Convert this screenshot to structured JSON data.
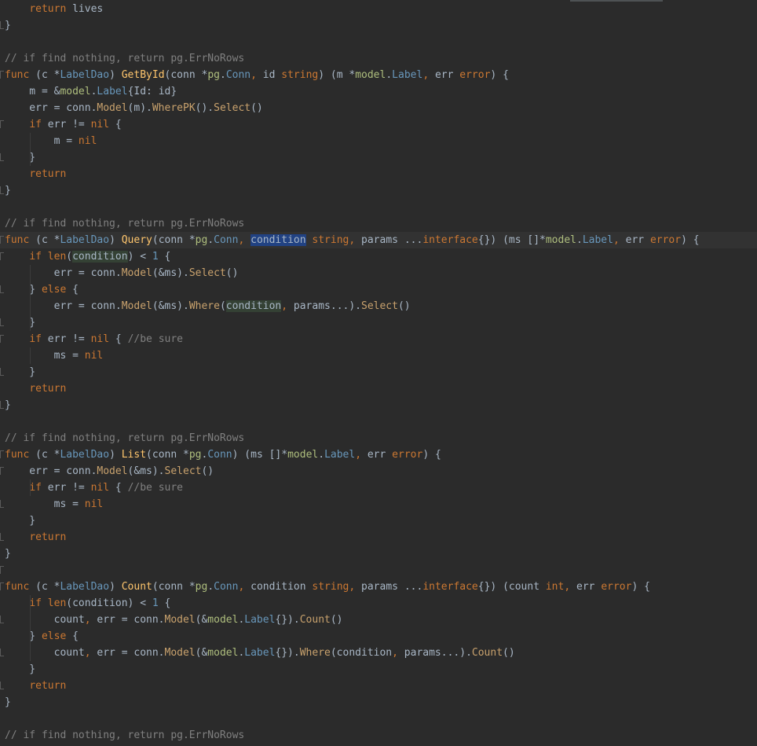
{
  "editor": {
    "lines": [
      [
        [
          "    "
        ],
        [
          "return",
          "kw"
        ],
        [
          " lives"
        ]
      ],
      [
        [
          "}"
        ]
      ],
      [
        [
          ""
        ]
      ],
      [
        [
          "// if find nothing, return pg.ErrNoRows",
          "cm"
        ]
      ],
      [
        [
          "func",
          "kw"
        ],
        [
          " (c *"
        ],
        [
          "LabelDao",
          "ty"
        ],
        [
          ") "
        ],
        [
          "GetById",
          "fn"
        ],
        [
          "(conn *"
        ],
        [
          "pg",
          "pk"
        ],
        [
          "."
        ],
        [
          "Conn",
          "ty"
        ],
        [
          ", ",
          "kw"
        ],
        [
          "id "
        ],
        [
          "string",
          "kw"
        ],
        [
          ") (m *"
        ],
        [
          "model",
          "pk"
        ],
        [
          "."
        ],
        [
          "Label",
          "ty"
        ],
        [
          ", ",
          "kw"
        ],
        [
          "err "
        ],
        [
          "error",
          "kw"
        ],
        [
          ") {"
        ]
      ],
      [
        [
          "    m = &"
        ],
        [
          "model",
          "pk"
        ],
        [
          "."
        ],
        [
          "Label",
          "ty"
        ],
        [
          "{Id: id}"
        ]
      ],
      [
        [
          "    err = conn."
        ],
        [
          "Model",
          "mcall"
        ],
        [
          "(m)."
        ],
        [
          "WherePK",
          "mcall"
        ],
        [
          "()."
        ],
        [
          "Select",
          "mcall"
        ],
        [
          "()"
        ]
      ],
      [
        [
          "    "
        ],
        [
          "if",
          "kw"
        ],
        [
          " err != "
        ],
        [
          "nil",
          "kw"
        ],
        [
          " {"
        ]
      ],
      [
        [
          "        m = "
        ],
        [
          "nil",
          "kw"
        ]
      ],
      [
        [
          "    }"
        ]
      ],
      [
        [
          "    "
        ],
        [
          "return",
          "kw"
        ]
      ],
      [
        [
          "}"
        ]
      ],
      [
        [
          ""
        ]
      ],
      [
        [
          "// if find nothing, return pg.ErrNoRows",
          "cm"
        ]
      ],
      [
        [
          "func",
          "kw"
        ],
        [
          " (c *"
        ],
        [
          "LabelDao",
          "ty"
        ],
        [
          ") "
        ],
        [
          "Query",
          "fn"
        ],
        [
          "(conn *"
        ],
        [
          "pg",
          "pk"
        ],
        [
          "."
        ],
        [
          "Conn",
          "ty"
        ],
        [
          ", ",
          "kw"
        ],
        [
          "condition",
          "hlsel"
        ],
        [
          " "
        ],
        [
          "string",
          "kw"
        ],
        [
          ", ",
          "kw"
        ],
        [
          "params ..."
        ],
        [
          "interface",
          "kw"
        ],
        [
          "{}) (ms []*"
        ],
        [
          "model",
          "pk"
        ],
        [
          "."
        ],
        [
          "Label",
          "ty"
        ],
        [
          ", ",
          "kw"
        ],
        [
          "err "
        ],
        [
          "error",
          "kw"
        ],
        [
          ") {"
        ]
      ],
      [
        [
          "    "
        ],
        [
          "if",
          "kw"
        ],
        [
          " "
        ],
        [
          "len",
          "kw"
        ],
        [
          "("
        ],
        [
          "condition",
          "hlref"
        ],
        [
          ") < "
        ],
        [
          "1",
          "nm"
        ],
        [
          " {"
        ]
      ],
      [
        [
          "        err = conn."
        ],
        [
          "Model",
          "mcall"
        ],
        [
          "(&ms)."
        ],
        [
          "Select",
          "mcall"
        ],
        [
          "()"
        ]
      ],
      [
        [
          "    } "
        ],
        [
          "else",
          "kw"
        ],
        [
          " {"
        ]
      ],
      [
        [
          "        err = conn."
        ],
        [
          "Model",
          "mcall"
        ],
        [
          "(&ms)."
        ],
        [
          "Where",
          "mcall"
        ],
        [
          "("
        ],
        [
          "condition",
          "hlref"
        ],
        [
          ", ",
          "kw"
        ],
        [
          "params...)."
        ],
        [
          "Select",
          "mcall"
        ],
        [
          "()"
        ]
      ],
      [
        [
          "    }"
        ]
      ],
      [
        [
          "    "
        ],
        [
          "if",
          "kw"
        ],
        [
          " err != "
        ],
        [
          "nil",
          "kw"
        ],
        [
          " { "
        ],
        [
          "//be sure",
          "cm"
        ]
      ],
      [
        [
          "        ms = "
        ],
        [
          "nil",
          "kw"
        ]
      ],
      [
        [
          "    }"
        ]
      ],
      [
        [
          "    "
        ],
        [
          "return",
          "kw"
        ]
      ],
      [
        [
          "}"
        ]
      ],
      [
        [
          ""
        ]
      ],
      [
        [
          "// if find nothing, return pg.ErrNoRows",
          "cm"
        ]
      ],
      [
        [
          "func",
          "kw"
        ],
        [
          " (c *"
        ],
        [
          "LabelDao",
          "ty"
        ],
        [
          ") "
        ],
        [
          "List",
          "fn"
        ],
        [
          "(conn *"
        ],
        [
          "pg",
          "pk"
        ],
        [
          "."
        ],
        [
          "Conn",
          "ty"
        ],
        [
          ") (ms []*"
        ],
        [
          "model",
          "pk"
        ],
        [
          "."
        ],
        [
          "Label",
          "ty"
        ],
        [
          ", ",
          "kw"
        ],
        [
          "err "
        ],
        [
          "error",
          "kw"
        ],
        [
          ") {"
        ]
      ],
      [
        [
          "    err = conn."
        ],
        [
          "Model",
          "mcall"
        ],
        [
          "(&ms)."
        ],
        [
          "Select",
          "mcall"
        ],
        [
          "()"
        ]
      ],
      [
        [
          "    "
        ],
        [
          "if",
          "kw"
        ],
        [
          " err != "
        ],
        [
          "nil",
          "kw"
        ],
        [
          " { "
        ],
        [
          "//be sure",
          "cm"
        ]
      ],
      [
        [
          "        ms = "
        ],
        [
          "nil",
          "kw"
        ]
      ],
      [
        [
          "    }"
        ]
      ],
      [
        [
          "    "
        ],
        [
          "return",
          "kw"
        ]
      ],
      [
        [
          "}"
        ]
      ],
      [
        [
          ""
        ]
      ],
      [
        [
          "func",
          "kw"
        ],
        [
          " (c *"
        ],
        [
          "LabelDao",
          "ty"
        ],
        [
          ") "
        ],
        [
          "Count",
          "fn"
        ],
        [
          "(conn *"
        ],
        [
          "pg",
          "pk"
        ],
        [
          "."
        ],
        [
          "Conn",
          "ty"
        ],
        [
          ", ",
          "kw"
        ],
        [
          "condition "
        ],
        [
          "string",
          "kw"
        ],
        [
          ", ",
          "kw"
        ],
        [
          "params ..."
        ],
        [
          "interface",
          "kw"
        ],
        [
          "{}) (count "
        ],
        [
          "int",
          "kw"
        ],
        [
          ", ",
          "kw"
        ],
        [
          "err "
        ],
        [
          "error",
          "kw"
        ],
        [
          ") {"
        ]
      ],
      [
        [
          "    "
        ],
        [
          "if",
          "kw"
        ],
        [
          " "
        ],
        [
          "len",
          "kw"
        ],
        [
          "(condition) < "
        ],
        [
          "1",
          "nm"
        ],
        [
          " {"
        ]
      ],
      [
        [
          "        count"
        ],
        [
          ", ",
          "kw"
        ],
        [
          "err = conn."
        ],
        [
          "Model",
          "mcall"
        ],
        [
          "(&"
        ],
        [
          "model",
          "pk"
        ],
        [
          "."
        ],
        [
          "Label",
          "ty"
        ],
        [
          "{})."
        ],
        [
          "Count",
          "mcall"
        ],
        [
          "()"
        ]
      ],
      [
        [
          "    } "
        ],
        [
          "else",
          "kw"
        ],
        [
          " {"
        ]
      ],
      [
        [
          "        count"
        ],
        [
          ", ",
          "kw"
        ],
        [
          "err = conn."
        ],
        [
          "Model",
          "mcall"
        ],
        [
          "(&"
        ],
        [
          "model",
          "pk"
        ],
        [
          "."
        ],
        [
          "Label",
          "ty"
        ],
        [
          "{})."
        ],
        [
          "Where",
          "mcall"
        ],
        [
          "(condition"
        ],
        [
          ", ",
          "kw"
        ],
        [
          "params...)."
        ],
        [
          "Count",
          "mcall"
        ],
        [
          "()"
        ]
      ],
      [
        [
          "    }"
        ]
      ],
      [
        [
          "    "
        ],
        [
          "return",
          "kw"
        ]
      ],
      [
        [
          "}"
        ]
      ],
      [
        [
          ""
        ]
      ],
      [
        [
          "// if find nothing, return pg.ErrNoRows",
          "cm"
        ]
      ]
    ],
    "current_line": 14,
    "fold_open_lines": [
      4,
      7,
      14,
      15,
      20,
      27,
      28,
      34,
      35
    ],
    "fold_close_lines": [
      1,
      9,
      11,
      17,
      19,
      22,
      24,
      30,
      32,
      37,
      39,
      41
    ]
  }
}
